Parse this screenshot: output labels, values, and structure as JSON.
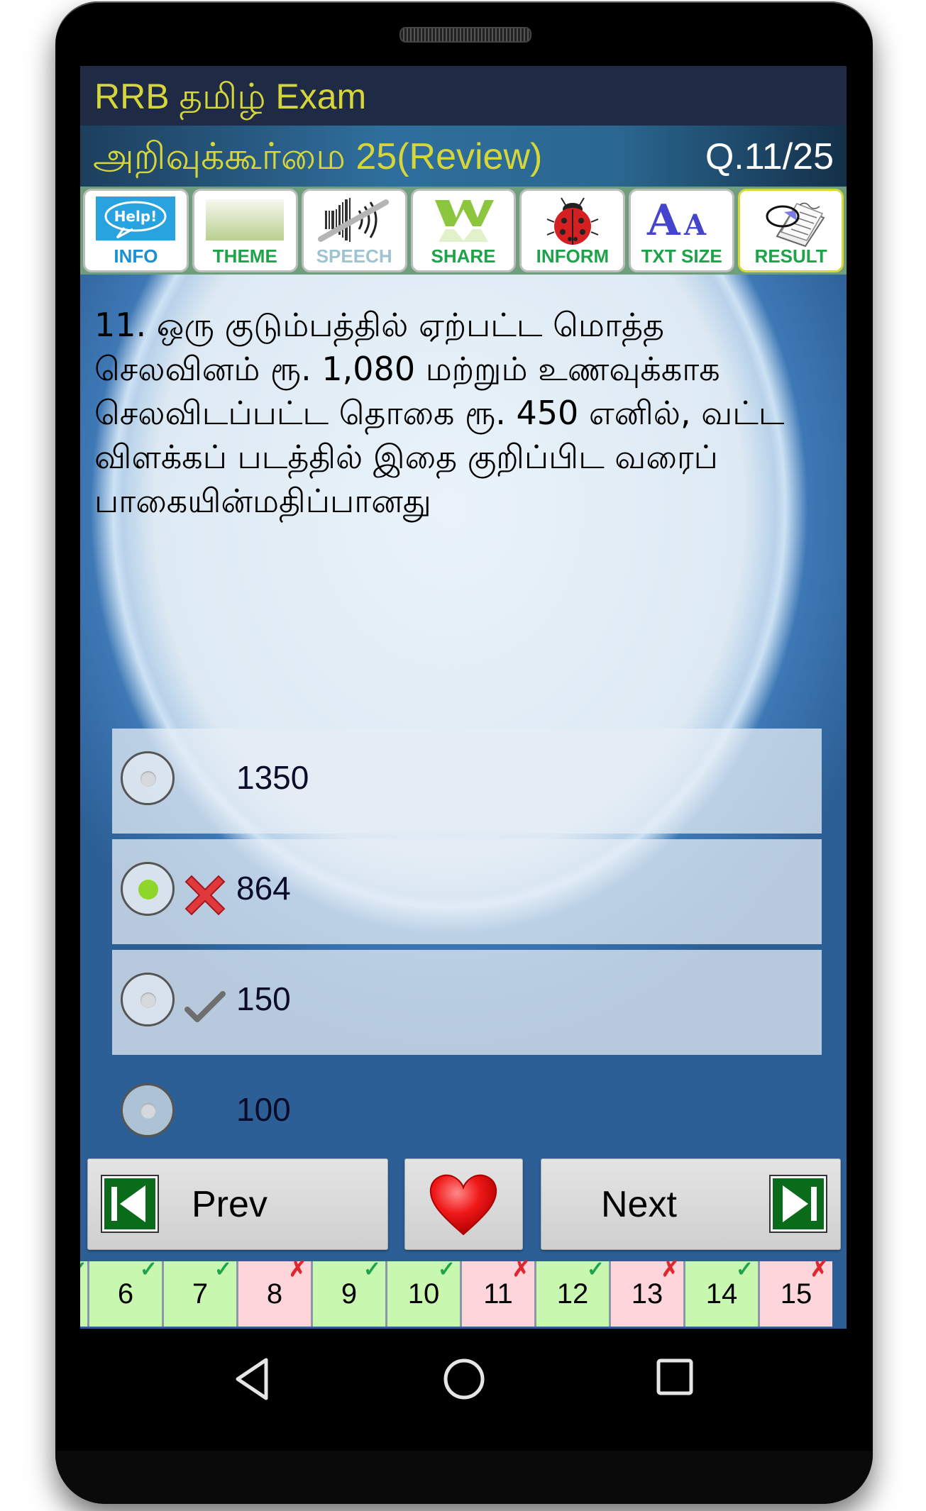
{
  "app": {
    "title": "RRB தமிழ் Exam",
    "subtitle": "அறிவுக்கூர்மை 25(Review)",
    "question_counter": "Q.11/25"
  },
  "toolbar": [
    {
      "label": "INFO",
      "icon": "help-bubble-icon",
      "color": "#1a8fd6"
    },
    {
      "label": "THEME",
      "icon": "theme-swatch-icon",
      "color": "#1fa34a"
    },
    {
      "label": "SPEECH",
      "icon": "speaker-muted-icon",
      "color": "#9fc3cf"
    },
    {
      "label": "SHARE",
      "icon": "share-w-icon",
      "color": "#1fa34a"
    },
    {
      "label": "INFORM",
      "icon": "ladybug-icon",
      "color": "#1fa34a"
    },
    {
      "label": "TXT SIZE",
      "icon": "text-size-icon",
      "color": "#1fa34a"
    },
    {
      "label": "RESULT",
      "icon": "result-report-icon",
      "color": "#1fa34a"
    }
  ],
  "question": {
    "text": "11. ஒரு குடும்பத்தில் ஏற்பட்ட மொத்த செலவினம் ரூ. 1,080 மற்றும் உணவுக்காக செலவிடப்பட்ட தொகை ரூ. 450 எனில், வட்ட விளக்கப் படத்தில் இதை குறிப்பிட வரைப் பாகையின்மதிப்பானது"
  },
  "options": [
    {
      "text": "1350",
      "selected": false,
      "mark": ""
    },
    {
      "text": "864",
      "selected": true,
      "mark": "wrong"
    },
    {
      "text": "150",
      "selected": false,
      "mark": "correct"
    },
    {
      "text": "100",
      "selected": false,
      "mark": ""
    }
  ],
  "nav": {
    "prev_label": "Prev",
    "next_label": "Next",
    "favorite_icon": "heart-icon"
  },
  "question_grid": [
    {
      "num": "",
      "status": "correct",
      "mark": "✓"
    },
    {
      "num": "6",
      "status": "correct",
      "mark": "✓"
    },
    {
      "num": "7",
      "status": "correct",
      "mark": "✓"
    },
    {
      "num": "8",
      "status": "wrong",
      "mark": "✗"
    },
    {
      "num": "9",
      "status": "correct",
      "mark": "✓"
    },
    {
      "num": "10",
      "status": "correct",
      "mark": "✓"
    },
    {
      "num": "11",
      "status": "wrong",
      "mark": "✗"
    },
    {
      "num": "12",
      "status": "correct",
      "mark": "✓"
    },
    {
      "num": "13",
      "status": "wrong",
      "mark": "✗"
    },
    {
      "num": "14",
      "status": "correct",
      "mark": "✓"
    },
    {
      "num": "15",
      "status": "wrong",
      "mark": "✗"
    }
  ],
  "colors": {
    "title_text": "#d6d63a",
    "correct_bg": "#c8f7b0",
    "wrong_bg": "#fdd5da",
    "selected_dot": "#8fd62a"
  }
}
